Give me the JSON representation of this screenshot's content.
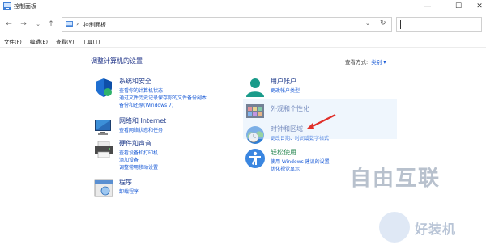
{
  "window": {
    "title": "控制面板"
  },
  "address": {
    "crumb": "控制面板",
    "separator": "›"
  },
  "menu": [
    "文件(F)",
    "编辑(E)",
    "查看(V)",
    "工具(T)"
  ],
  "content": {
    "heading": "调整计算机的设置",
    "view_by_label": "查看方式:",
    "view_by_value": "类别 ▾"
  },
  "categories_left": [
    {
      "title": "系统和安全",
      "links": [
        "查看你的计算机状态",
        "通过文件历史记录保存你的文件备份副本",
        "备份和还原(Windows 7)"
      ]
    },
    {
      "title": "网络和 Internet",
      "links": [
        "查看网络状态和任务"
      ]
    },
    {
      "title": "硬件和声音",
      "links": [
        "查看设备和打印机",
        "添加设备",
        "调整常用移动设置"
      ]
    },
    {
      "title": "程序",
      "links": [
        "卸载程序"
      ]
    }
  ],
  "categories_right": [
    {
      "title": "用户帐户",
      "links": [
        "更改帐户类型"
      ]
    },
    {
      "title": "外观和个性化",
      "links": []
    },
    {
      "title": "时钟和区域",
      "links": [
        "更改日期、时间或数字格式"
      ]
    },
    {
      "title": "轻松使用",
      "links": [
        "使用 Windows 建议的设置",
        "优化视觉显示"
      ]
    }
  ],
  "watermark": {
    "word": "自由互联",
    "badge_text": "好装机"
  },
  "colors": {
    "link": "#1a5bd6",
    "title": "#1e3a8a",
    "heading": "#1e3287",
    "arrow": "#e0302a"
  }
}
